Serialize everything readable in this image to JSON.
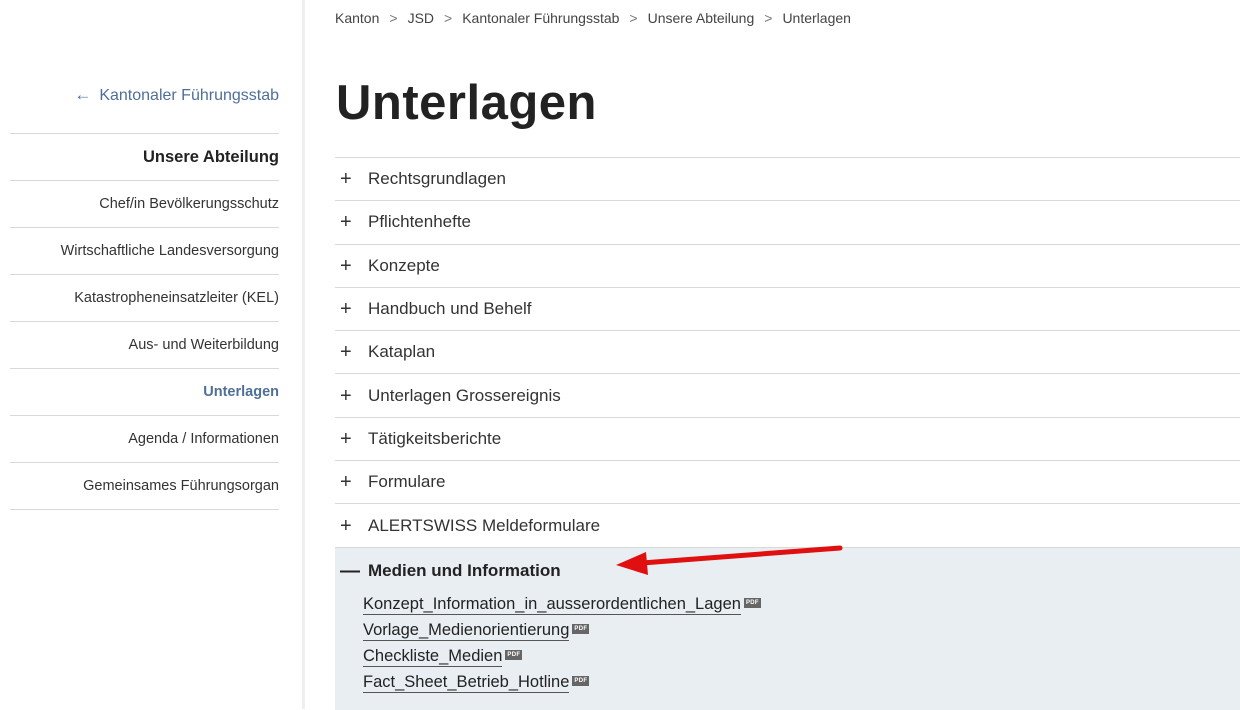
{
  "breadcrumb": {
    "items": [
      "Kanton",
      "JSD",
      "Kantonaler Führungsstab",
      "Unsere Abteilung",
      "Unterlagen"
    ],
    "separator": ">"
  },
  "sidebar": {
    "back_label": "Kantonaler Führungsstab",
    "items": [
      {
        "label": "Unsere Abteilung"
      },
      {
        "label": "Chef/in Bevölkerungsschutz"
      },
      {
        "label": "Wirtschaftliche Landesversorgung"
      },
      {
        "label": "Katastropheneinsatzleiter (KEL)"
      },
      {
        "label": "Aus- und Weiterbildung"
      },
      {
        "label": "Unterlagen"
      },
      {
        "label": "Agenda / Informationen"
      },
      {
        "label": "Gemeinsames Führungsorgan"
      }
    ],
    "active_color": "#4f6f9a"
  },
  "page": {
    "title": "Unterlagen"
  },
  "accordion": {
    "collapsed": [
      {
        "label": "Rechtsgrundlagen"
      },
      {
        "label": "Pflichtenhefte"
      },
      {
        "label": "Konzepte"
      },
      {
        "label": "Handbuch und Behelf"
      },
      {
        "label": "Kataplan"
      },
      {
        "label": "Unterlagen Grossereignis"
      },
      {
        "label": "Tätigkeitsberichte"
      },
      {
        "label": "Formulare"
      },
      {
        "label": "ALERTSWISS Meldeformulare"
      }
    ],
    "expanded": {
      "label": "Medien und Information",
      "documents": [
        {
          "name": "Konzept_Information_in_ausserordentlichen_Lagen",
          "type": "PDF"
        },
        {
          "name": "Vorlage_Medienorientierung",
          "type": "PDF"
        },
        {
          "name": "Checkliste_Medien",
          "type": "PDF"
        },
        {
          "name": "Fact_Sheet_Betrieb_Hotline",
          "type": "PDF"
        }
      ]
    },
    "expanded_bg": "#e9eef2"
  },
  "annotation": {
    "color": "#e01010"
  }
}
